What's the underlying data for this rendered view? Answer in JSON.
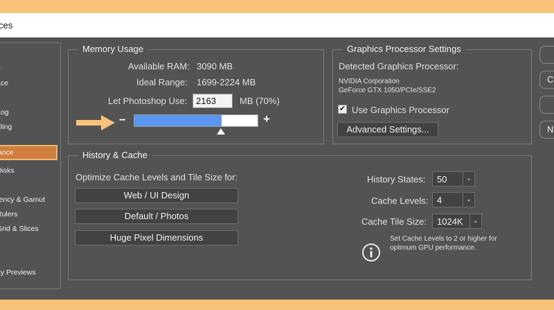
{
  "window": {
    "title": "ces"
  },
  "sidebar": {
    "items": [
      {
        "label": "e"
      },
      {
        "label": "ace"
      },
      {
        "label": "Log"
      },
      {
        "label": "dling"
      },
      {
        "label": "ance",
        "selected": true
      },
      {
        "label": "Disks"
      },
      {
        "label": "rency & Gamut"
      },
      {
        "label": "Rulers"
      },
      {
        "label": "Grid & Slices"
      },
      {
        "label": "s"
      },
      {
        "label": "gy Previews"
      }
    ]
  },
  "memory": {
    "title": "Memory Usage",
    "available_label": "Available RAM:",
    "available_value": "3090 MB",
    "ideal_label": "Ideal Range:",
    "ideal_value": "1699-2224 MB",
    "let_label": "Let Photoshop Use:",
    "let_value": "2163",
    "let_suffix": "MB (70%)",
    "minus": "–",
    "plus": "+",
    "slider_fraction": 0.7
  },
  "gpu": {
    "title": "Graphics Processor Settings",
    "detected_label": "Detected Graphics Processor:",
    "vendor": "NVIDIA Corporation",
    "model": "GeForce GTX 1050/PCIe/SSE2",
    "use_label": "Use Graphics Processor",
    "use_checked": true,
    "advanced_label": "Advanced Settings..."
  },
  "history": {
    "title": "History & Cache",
    "optimize_label": "Optimize Cache Levels and Tile Size for:",
    "buttons": [
      "Web / UI Design",
      "Default / Photos",
      "Huge Pixel Dimensions"
    ],
    "states_label": "History States:",
    "states_value": "50",
    "levels_label": "Cache Levels:",
    "levels_value": "4",
    "tile_label": "Cache Tile Size:",
    "tile_value": "1024K",
    "note_line1": "Set Cache Levels to 2 or higher for",
    "note_line2": "optimum GPU performance."
  },
  "right_buttons": [
    "",
    "C",
    "",
    "N"
  ],
  "colors": {
    "background": "#535353",
    "accent_selected": "#cf7e3e",
    "slider_fill": "#5b96f0",
    "annotation_arrow": "#f7c27a"
  }
}
